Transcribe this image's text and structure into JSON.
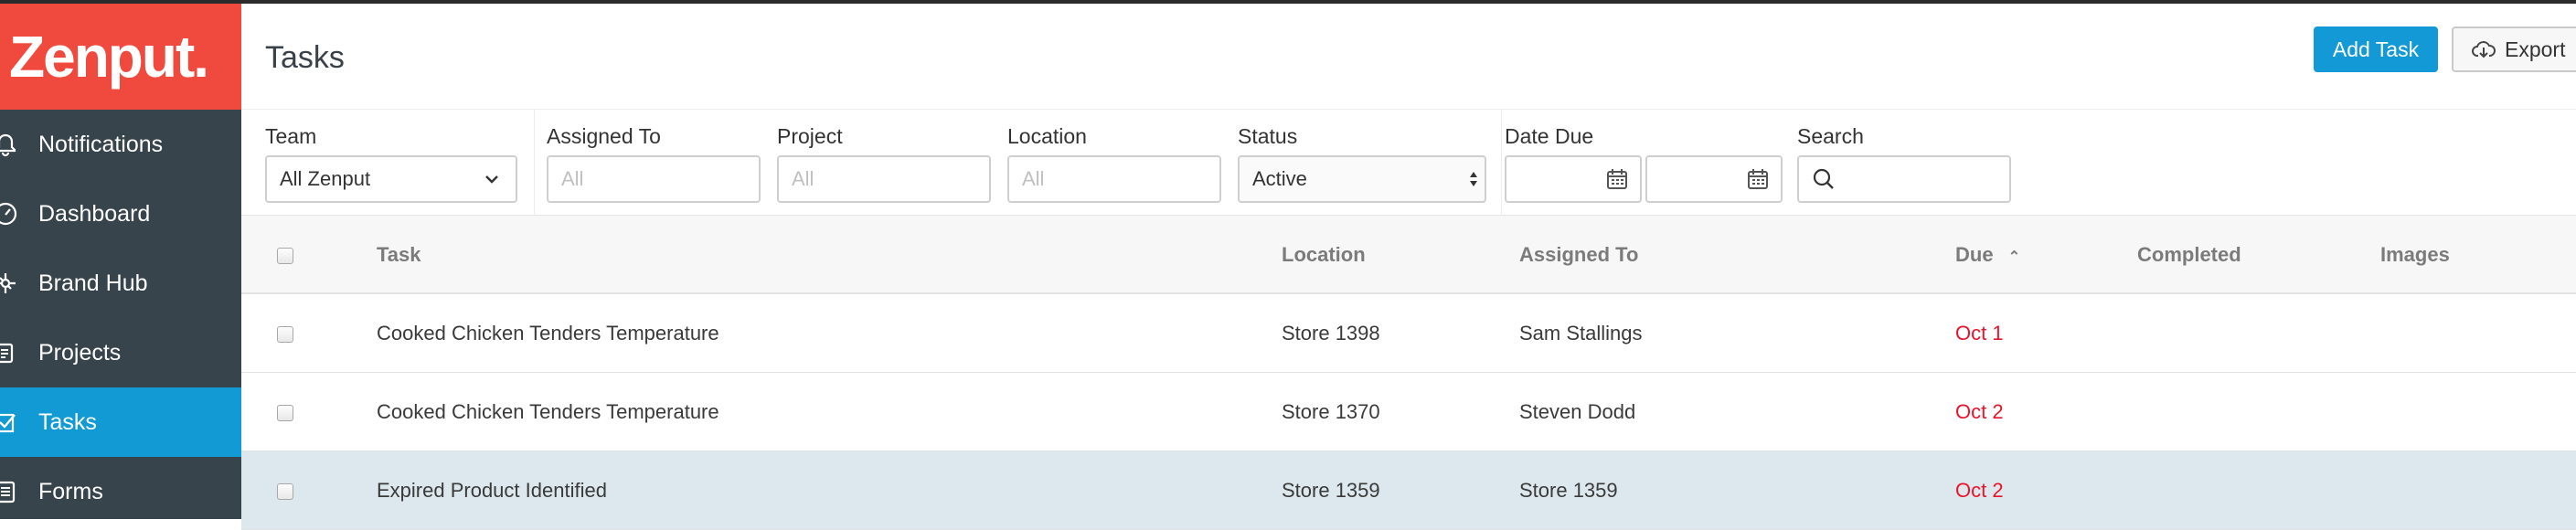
{
  "app": {
    "logo_text": "Zenput."
  },
  "sidebar": {
    "items": [
      {
        "label": "Notifications",
        "icon": "bell-icon",
        "active": false
      },
      {
        "label": "Dashboard",
        "icon": "gauge-icon",
        "active": false
      },
      {
        "label": "Brand Hub",
        "icon": "hub-icon",
        "active": false
      },
      {
        "label": "Projects",
        "icon": "clipboard-icon",
        "active": false
      },
      {
        "label": "Tasks",
        "icon": "checkbox-icon",
        "active": true
      },
      {
        "label": "Forms",
        "icon": "form-icon",
        "active": false
      }
    ]
  },
  "header": {
    "title": "Tasks",
    "add_task_label": "Add Task",
    "export_label": "Export"
  },
  "filters": {
    "team": {
      "label": "Team",
      "value": "All Zenput"
    },
    "assigned_to": {
      "label": "Assigned To",
      "placeholder": "All"
    },
    "project": {
      "label": "Project",
      "placeholder": "All"
    },
    "location": {
      "label": "Location",
      "placeholder": "All"
    },
    "status": {
      "label": "Status",
      "value": "Active"
    },
    "date_due": {
      "label": "Date Due"
    },
    "search": {
      "label": "Search"
    }
  },
  "table": {
    "columns": {
      "task": "Task",
      "location": "Location",
      "assigned_to": "Assigned To",
      "due": "Due",
      "completed": "Completed",
      "images": "Images"
    },
    "rows": [
      {
        "task": "Cooked Chicken Tenders Temperature",
        "location": "Store 1398",
        "assigned_to": "Sam Stallings",
        "due": "Oct 1"
      },
      {
        "task": "Cooked Chicken Tenders Temperature",
        "location": "Store 1370",
        "assigned_to": "Steven Dodd",
        "due": "Oct 2"
      },
      {
        "task": "Expired Product Identified",
        "location": "Store 1359",
        "assigned_to": "Store 1359",
        "due": "Oct 2"
      }
    ]
  },
  "colors": {
    "logo_bg": "#f04a3f",
    "sidebar_bg": "#38444c",
    "accent": "#119ad4",
    "due_red": "#e8142a",
    "highlight_row": "#dde8ee"
  }
}
